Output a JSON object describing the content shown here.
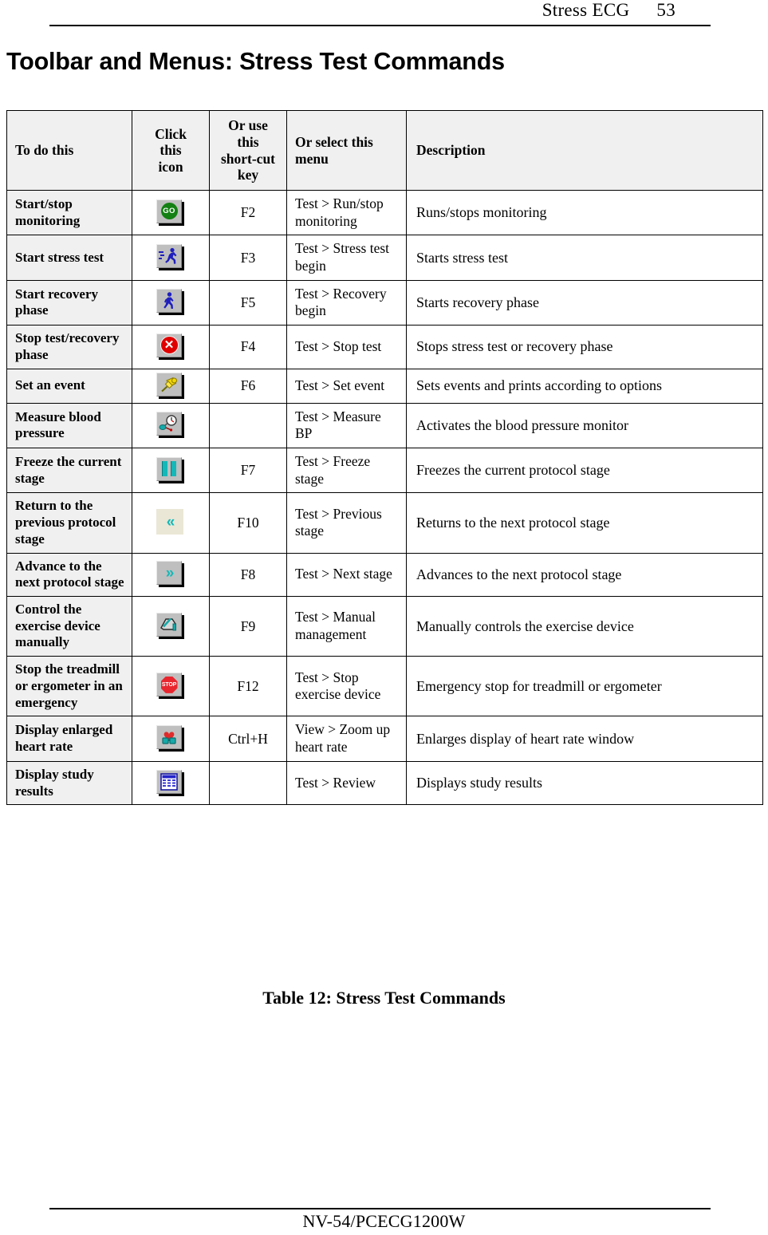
{
  "header": {
    "running_title": "Stress ECG",
    "page_number": "53"
  },
  "page_title": "Toolbar and Menus: Stress Test Commands",
  "table": {
    "caption": "Table 12: Stress Test Commands",
    "columns": {
      "todo": "To do this",
      "icon": "Click this icon",
      "icon_l1": "Click",
      "icon_l2": "this",
      "icon_l3": "icon",
      "key": "Or use this short-cut key",
      "key_l1": "Or use",
      "key_l2": "this",
      "key_l3": "short-cut",
      "key_l4": "key",
      "menu": "Or select this menu",
      "description": "Description"
    },
    "rows": [
      {
        "todo": "Start/stop monitoring",
        "icon_name": "go-icon",
        "icon_label": "GO",
        "key": "F2",
        "menu": "Test > Run/stop monitoring",
        "description": "Runs/stops monitoring"
      },
      {
        "todo": "Start stress test",
        "icon_name": "running-person-icon",
        "icon_label": "",
        "key": "F3",
        "menu": "Test > Stress test begin",
        "description": "Starts stress test"
      },
      {
        "todo": "Start recovery phase",
        "icon_name": "walking-person-icon",
        "icon_label": "",
        "key": "F5",
        "menu": "Test > Recovery begin",
        "description": "Starts recovery phase"
      },
      {
        "todo": "Stop test/recovery phase",
        "icon_name": "red-x-stop-icon",
        "icon_label": "✕",
        "key": "F4",
        "menu": "Test > Stop test",
        "description": "Stops stress test or recovery phase"
      },
      {
        "todo": "Set an event",
        "icon_name": "pushpin-icon",
        "icon_label": "",
        "key": "F6",
        "menu": "Test > Set event",
        "description": "Sets events and prints according to options"
      },
      {
        "todo": "Measure blood pressure",
        "icon_name": "blood-pressure-gauge-icon",
        "icon_label": "",
        "key": "",
        "menu": "Test > Measure BP",
        "description": "Activates the blood pressure monitor"
      },
      {
        "todo": "Freeze the current stage",
        "icon_name": "pause-icon",
        "icon_label": "",
        "key": "F7",
        "menu": "Test > Freeze stage",
        "description": "Freezes the current protocol stage"
      },
      {
        "todo": "Return to the previous protocol stage",
        "icon_name": "double-chevron-left-icon",
        "icon_label": "«",
        "key": "F10",
        "menu": "Test > Previous stage",
        "description": "Returns to the next protocol stage"
      },
      {
        "todo": "Advance to the next protocol stage",
        "icon_name": "double-chevron-right-icon",
        "icon_label": "»",
        "key": "F8",
        "menu": "Test > Next stage",
        "description": "Advances to the next protocol stage"
      },
      {
        "todo": "Control the exercise device manually",
        "icon_name": "manual-control-hand-icon",
        "icon_label": "",
        "key": "F9",
        "menu": "Test > Manual management",
        "description": "Manually controls the exercise device"
      },
      {
        "todo": "Stop the treadmill or ergometer in an emergency",
        "icon_name": "stop-sign-icon",
        "icon_label": "STOP",
        "key": "F12",
        "menu": "Test > Stop exercise device",
        "description": "Emergency stop for treadmill or ergometer"
      },
      {
        "todo": "Display enlarged heart rate",
        "icon_name": "heart-zoom-icon",
        "icon_label": "",
        "key": "Ctrl+H",
        "menu": "View > Zoom up heart rate",
        "description": "Enlarges display of heart rate window"
      },
      {
        "todo": "Display study results",
        "icon_name": "study-results-grid-icon",
        "icon_label": "",
        "key": "",
        "menu": "Test > Review",
        "description": "Displays study results"
      }
    ]
  },
  "footer": {
    "document_code": "NV-54/PCECG1200W"
  },
  "colors": {
    "go_green": "#128012",
    "stop_red": "#e00000",
    "accent_teal": "#14b8b8",
    "pushpin_yellow": "#f2d600",
    "figure_blue": "#1f1fbe",
    "header_fill": "#f0f0f0",
    "prev_icon_bg": "#eae7d6"
  }
}
